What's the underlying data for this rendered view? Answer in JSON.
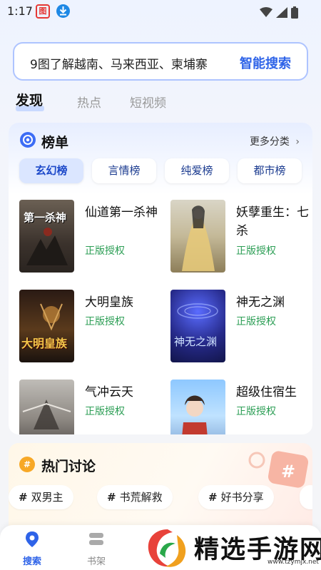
{
  "status_bar": {
    "time": "1:17",
    "app_badge": "图"
  },
  "search": {
    "query": "9图了解越南、马来西亚、柬埔寨",
    "action_label": "智能搜索"
  },
  "tabs": [
    {
      "label": "发现",
      "active": true
    },
    {
      "label": "热点",
      "active": false
    },
    {
      "label": "短视频",
      "active": false
    }
  ],
  "ranking": {
    "title": "榜单",
    "more_label": "更多分类",
    "categories": [
      {
        "label": "玄幻榜",
        "active": true
      },
      {
        "label": "言情榜",
        "active": false
      },
      {
        "label": "纯爱榜",
        "active": false
      },
      {
        "label": "都市榜",
        "active": false
      }
    ],
    "books": [
      {
        "title": "仙道第一杀神",
        "tag": "正版授权",
        "cover_text": "第一杀神"
      },
      {
        "title": "妖孽重生：七杀",
        "tag": "正版授权"
      },
      {
        "title": "大明皇族",
        "tag": "正版授权",
        "cover_text": "大明皇族"
      },
      {
        "title": "神无之渊",
        "tag": "正版授权",
        "cover_text": "神无之渊"
      },
      {
        "title": "气冲云天",
        "tag": "正版授权"
      },
      {
        "title": "超级住宿生",
        "tag": "正版授权"
      }
    ]
  },
  "hot": {
    "title": "热门讨论",
    "topics": [
      "双男主",
      "书荒解救",
      "好书分享"
    ]
  },
  "bottom_nav": [
    {
      "label": "搜索",
      "active": true
    },
    {
      "label": "书架",
      "active": false
    }
  ],
  "watermark": {
    "text": "精选手游网",
    "url": "www.tzymjx.net"
  },
  "colors": {
    "accent": "#2e63e8",
    "tag_green": "#2c9e55",
    "search_border": "#aec4ff"
  }
}
